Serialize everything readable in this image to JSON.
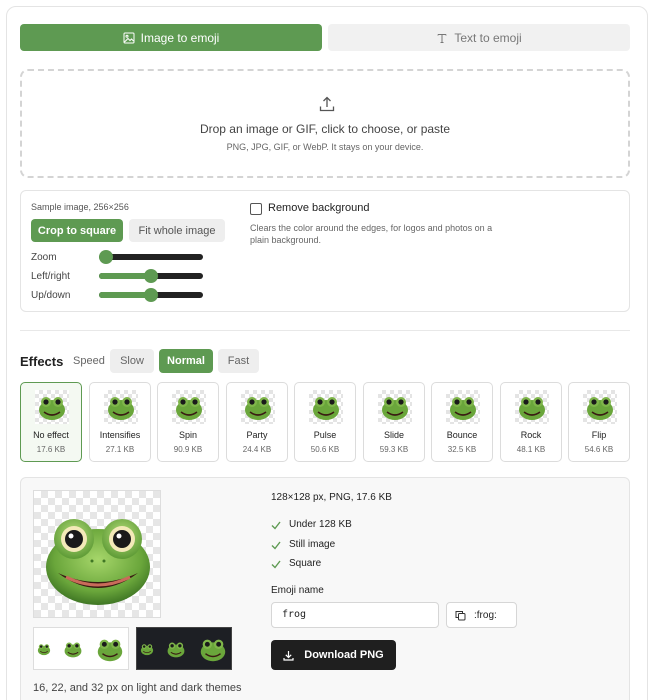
{
  "tabs": {
    "image_to_emoji": "Image to emoji",
    "text_to_emoji": "Text to emoji"
  },
  "dropzone": {
    "title": "Drop an image or GIF, click to choose, or paste",
    "subtitle": "PNG, JPG, GIF, or WebP. It stays on your device."
  },
  "sample": {
    "label": "Sample image, 256×256",
    "crop_button": "Crop to square",
    "fit_button": "Fit whole image",
    "sliders": [
      {
        "label": "Zoom",
        "value": 0.0
      },
      {
        "label": "Left/right",
        "value": 0.5
      },
      {
        "label": "Up/down",
        "value": 0.5
      }
    ],
    "remove_bg_label": "Remove background",
    "remove_bg_checked": false,
    "remove_bg_desc": "Clears the color around the edges, for logos and photos on a plain background."
  },
  "effects": {
    "title": "Effects",
    "speed_label": "Speed",
    "speeds": [
      "Slow",
      "Normal",
      "Fast"
    ],
    "selected_speed": "Normal",
    "items": [
      {
        "name": "No effect",
        "size": "17.6 KB"
      },
      {
        "name": "Intensifies",
        "size": "27.1 KB"
      },
      {
        "name": "Spin",
        "size": "90.9 KB"
      },
      {
        "name": "Party",
        "size": "24.4 KB"
      },
      {
        "name": "Pulse",
        "size": "50.6 KB"
      },
      {
        "name": "Slide",
        "size": "59.3 KB"
      },
      {
        "name": "Bounce",
        "size": "32.5 KB"
      },
      {
        "name": "Rock",
        "size": "48.1 KB"
      },
      {
        "name": "Flip",
        "size": "54.6 KB"
      }
    ],
    "selected": "No effect"
  },
  "preview": {
    "info": "128×128 px, PNG, 17.6 KB",
    "checks": [
      "Under 128 KB",
      "Still image",
      "Square"
    ],
    "emoji_name_label": "Emoji name",
    "emoji_name_value": "frog",
    "copy_label": ":frog:",
    "download_label": "Download PNG",
    "themes_caption": "16, 22, and 32 px on light and dark themes"
  },
  "colors": {
    "accent": "#5e9a52",
    "dark_button": "#1f1f1f"
  }
}
